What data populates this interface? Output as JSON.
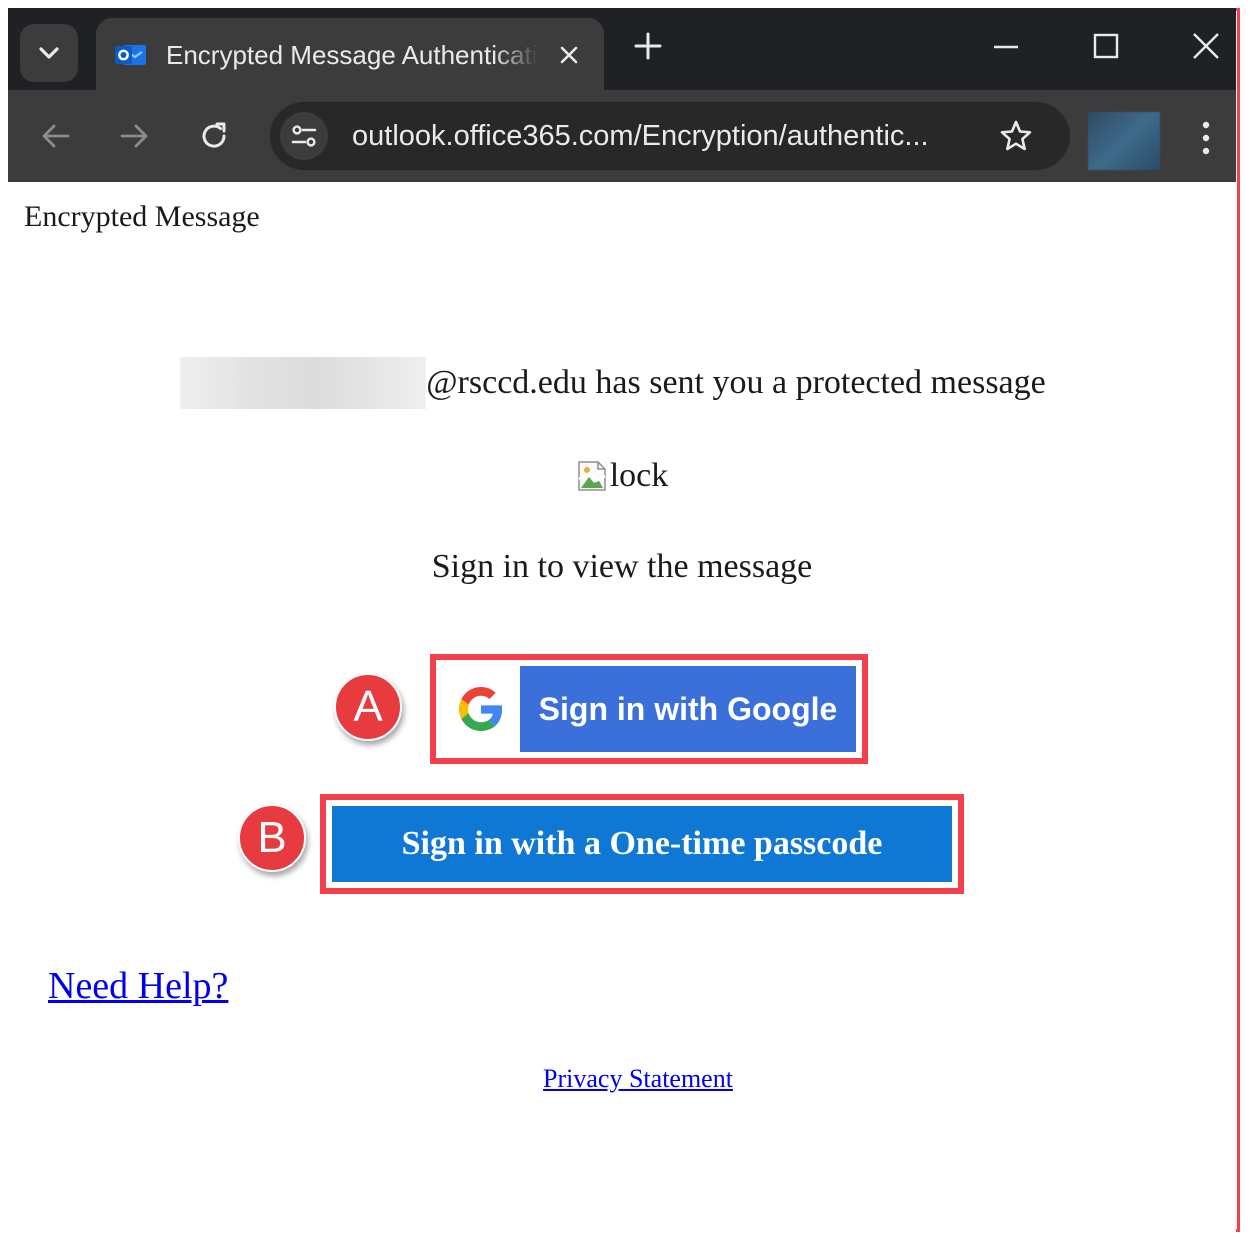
{
  "browser": {
    "tab_title": "Encrypted Message Authentication",
    "url": "outlook.office365.com/Encryption/authentic...",
    "icons": [
      "tab-search-icon",
      "outlook-icon",
      "close-icon",
      "plus-icon",
      "minimize-icon",
      "maximize-icon",
      "close-window-icon",
      "back-icon",
      "forward-icon",
      "reload-icon",
      "site-info-icon",
      "star-icon",
      "profile-avatar",
      "more-menu-icon"
    ]
  },
  "page": {
    "header_title": "Encrypted Message",
    "sender_suffix": "@rsccd.edu has sent you a protected message",
    "lock_alt": "lock",
    "signin_prompt": "Sign in to view the message",
    "google_button_label": "Sign in with Google",
    "otp_button_label": "Sign in with a One-time passcode",
    "need_help_link": "Need Help?",
    "privacy_link": "Privacy Statement"
  },
  "annotations": {
    "marker_a": "A",
    "marker_b": "B",
    "highlight_color": "#f2414d"
  },
  "colors": {
    "google_button": "#3b6fd9",
    "otp_button": "#0f77d4",
    "link": "#0000ee"
  }
}
